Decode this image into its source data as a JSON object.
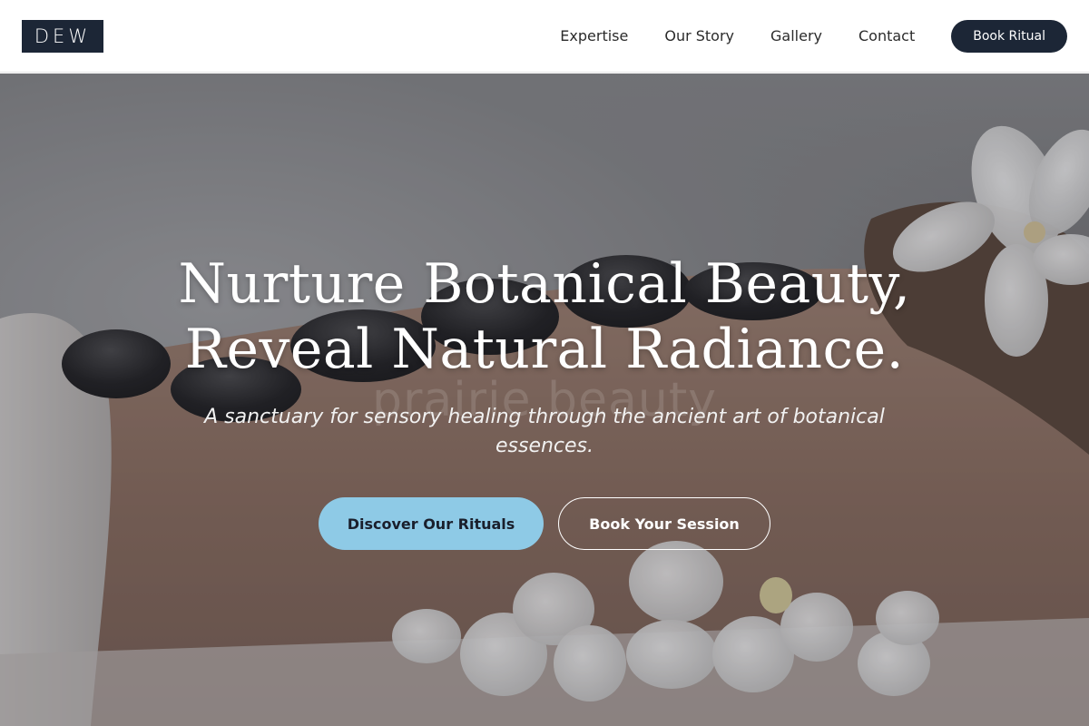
{
  "header": {
    "logo_text": "DEW",
    "nav": [
      {
        "label": "Expertise"
      },
      {
        "label": "Our Story"
      },
      {
        "label": "Gallery"
      },
      {
        "label": "Contact"
      }
    ],
    "cta_label": "Book Ritual"
  },
  "hero": {
    "headline_line1": "Nurture Botanical Beauty,",
    "headline_line2": "Reveal Natural Radiance.",
    "watermark": "prairie beauty",
    "subtitle": "A sanctuary for sensory healing through the ancient art of botanical essences.",
    "primary_button": "Discover Our Rituals",
    "secondary_button": "Book Your Session",
    "image_semantic": "spa-hot-stone-massage-with-orchids"
  },
  "colors": {
    "brand_dark": "#1c2636",
    "accent_blue": "#8ecae6",
    "white": "#ffffff"
  }
}
